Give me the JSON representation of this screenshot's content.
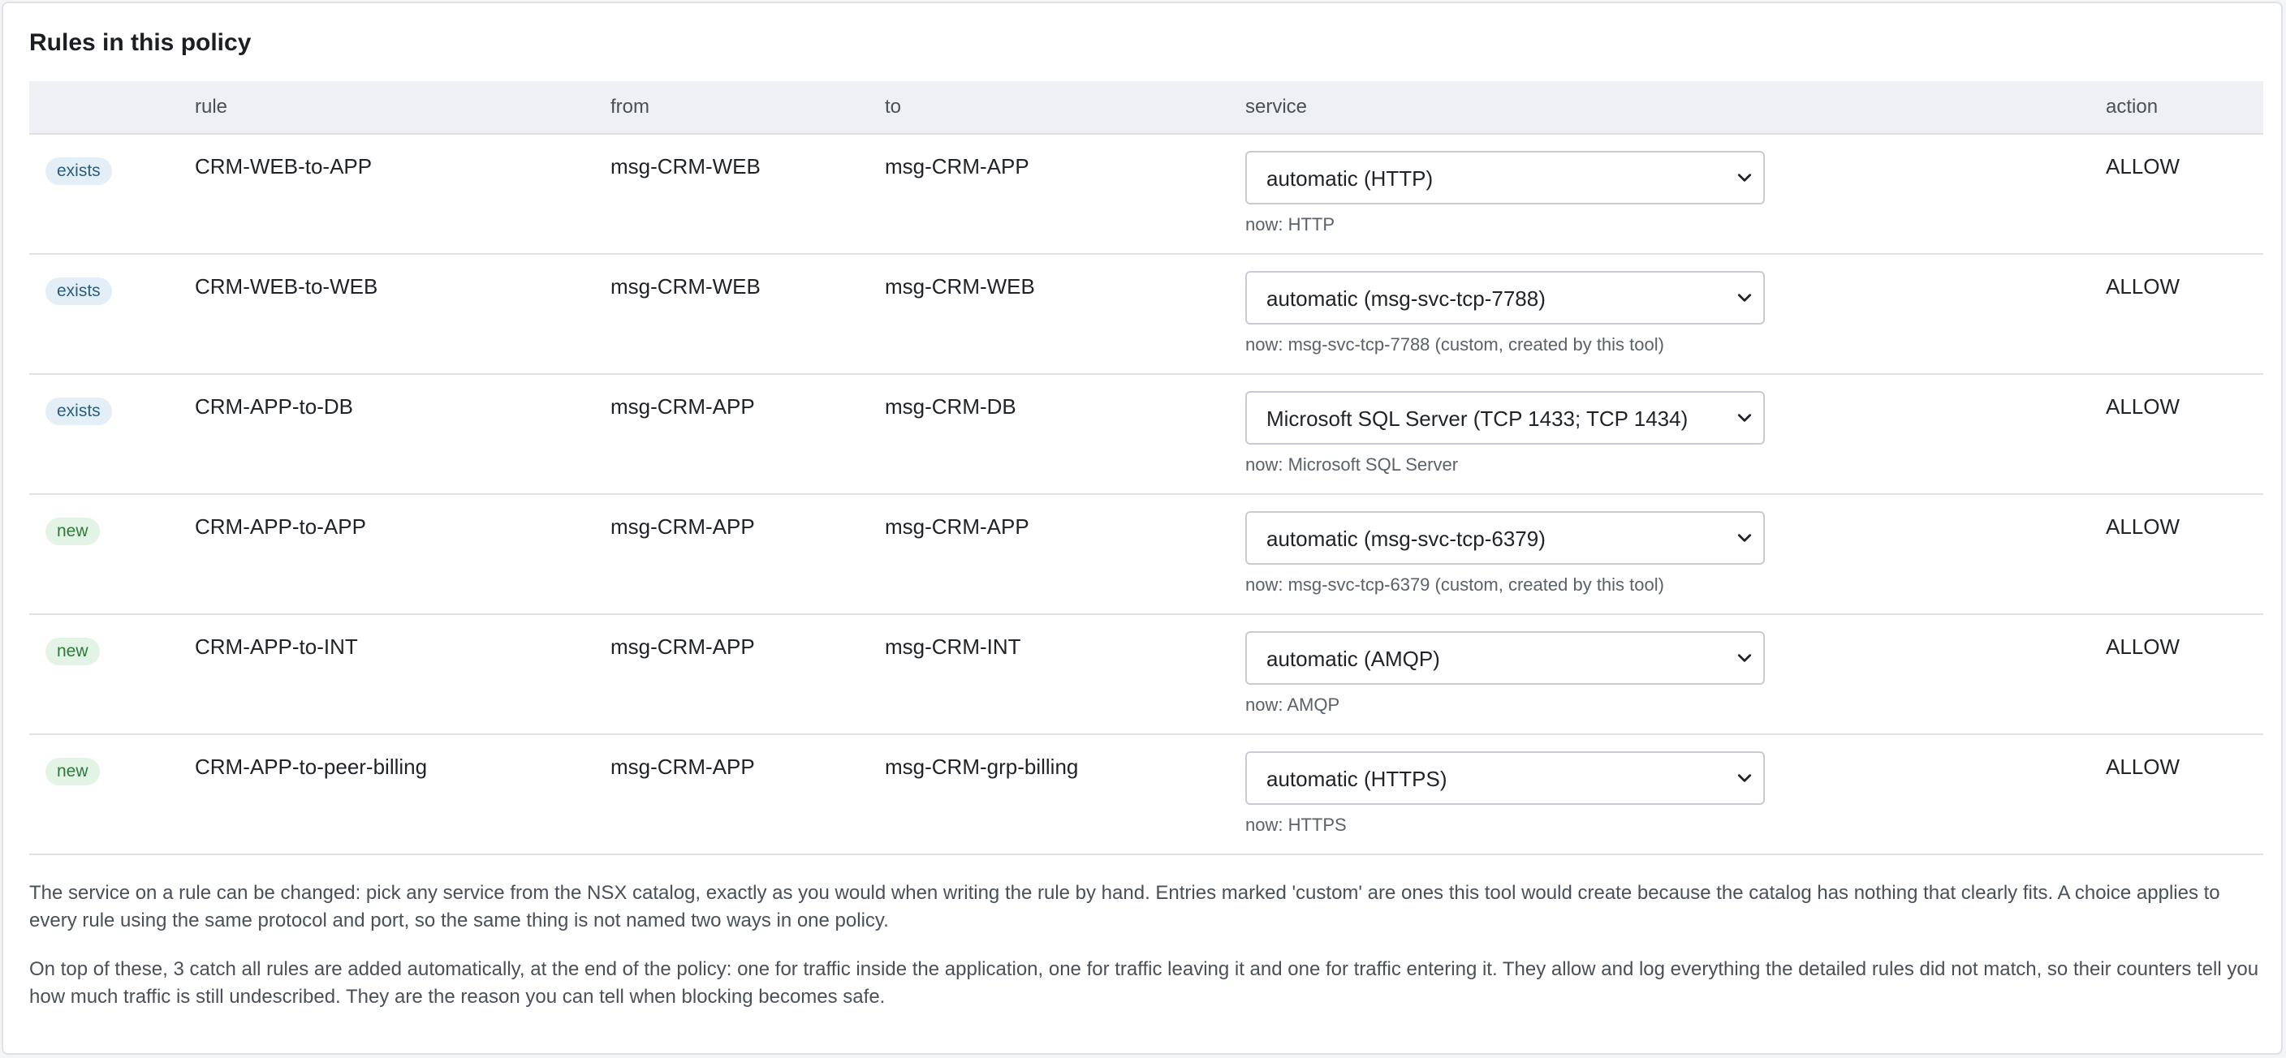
{
  "panel": {
    "title": "Rules in this policy"
  },
  "columns": {
    "status": "",
    "rule": "rule",
    "from": "from",
    "to": "to",
    "service": "service",
    "action": "action"
  },
  "rows": [
    {
      "status": "exists",
      "rule": "CRM-WEB-to-APP",
      "from": "msg-CRM-WEB",
      "to": "msg-CRM-APP",
      "service_selected": "automatic (HTTP)",
      "service_now": "now: HTTP",
      "action": "ALLOW"
    },
    {
      "status": "exists",
      "rule": "CRM-WEB-to-WEB",
      "from": "msg-CRM-WEB",
      "to": "msg-CRM-WEB",
      "service_selected": "automatic (msg-svc-tcp-7788)",
      "service_now": "now: msg-svc-tcp-7788 (custom, created by this tool)",
      "action": "ALLOW"
    },
    {
      "status": "exists",
      "rule": "CRM-APP-to-DB",
      "from": "msg-CRM-APP",
      "to": "msg-CRM-DB",
      "service_selected": "Microsoft SQL Server (TCP 1433; TCP 1434)",
      "service_now": "now: Microsoft SQL Server",
      "action": "ALLOW"
    },
    {
      "status": "new",
      "rule": "CRM-APP-to-APP",
      "from": "msg-CRM-APP",
      "to": "msg-CRM-APP",
      "service_selected": "automatic (msg-svc-tcp-6379)",
      "service_now": "now: msg-svc-tcp-6379 (custom, created by this tool)",
      "action": "ALLOW"
    },
    {
      "status": "new",
      "rule": "CRM-APP-to-INT",
      "from": "msg-CRM-APP",
      "to": "msg-CRM-INT",
      "service_selected": "automatic (AMQP)",
      "service_now": "now: AMQP",
      "action": "ALLOW"
    },
    {
      "status": "new",
      "rule": "CRM-APP-to-peer-billing",
      "from": "msg-CRM-APP",
      "to": "msg-CRM-grp-billing",
      "service_selected": "automatic (HTTPS)",
      "service_now": "now: HTTPS",
      "action": "ALLOW"
    }
  ],
  "notes": {
    "service_change": "The service on a rule can be changed: pick any service from the NSX catalog, exactly as you would when writing the rule by hand. Entries marked 'custom' are ones this tool would create because the catalog has nothing that clearly fits. A choice applies to every rule using the same protocol and port, so the same thing is not named two ways in one policy.",
    "catch_all": "On top of these, 3 catch all rules are added automatically, at the end of the policy: one for traffic inside the application, one for traffic leaving it and one for traffic entering it. They allow and log everything the detailed rules did not match, so their counters tell you how much traffic is still undescribed. They are the reason you can tell when blocking becomes safe."
  },
  "icons": {
    "select_arrow": "chevron-down-icon"
  }
}
